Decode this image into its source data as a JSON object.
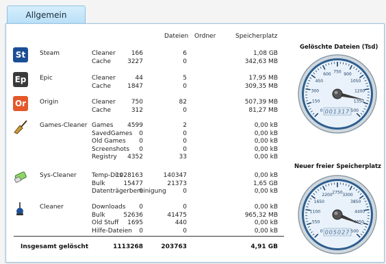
{
  "tabs": [
    {
      "label": "Allgemein"
    }
  ],
  "columns": {
    "files": "Dateien",
    "folders": "Ordner",
    "storage": "Speicherplatz"
  },
  "apps": [
    {
      "icon_text": "St",
      "icon_color": "#1b4f95",
      "name": "Steam",
      "rows": [
        {
          "category": "Cleaner",
          "files": "166",
          "folders": "6",
          "storage": "1,08 GB"
        },
        {
          "category": "Cache",
          "files": "3227",
          "folders": "0",
          "storage": "342,63 MB"
        }
      ]
    },
    {
      "icon_text": "Ep",
      "icon_color": "#3a3a3a",
      "name": "Epic",
      "rows": [
        {
          "category": "Cleaner",
          "files": "44",
          "folders": "5",
          "storage": "17,95 MB"
        },
        {
          "category": "Cache",
          "files": "1847",
          "folders": "0",
          "storage": "309,35 MB"
        }
      ]
    },
    {
      "icon_text": "Or",
      "icon_color": "#e4582a",
      "name": "Origin",
      "rows": [
        {
          "category": "Cleaner",
          "files": "750",
          "folders": "82",
          "storage": "507,39 MB"
        },
        {
          "category": "Cache",
          "files": "312",
          "folders": "0",
          "storage": "81,27 MB"
        }
      ]
    },
    {
      "icon_text": "",
      "icon_name": "broom-icon",
      "name": "Games-Cleaner",
      "rows": [
        {
          "category": "Games",
          "files": "4599",
          "folders": "2",
          "storage": "0,00 kB"
        },
        {
          "category": "SavedGames",
          "files": "0",
          "folders": "0",
          "storage": "0,00 kB"
        },
        {
          "category": "Old Games",
          "files": "0",
          "folders": "0",
          "storage": "0,00 kB"
        },
        {
          "category": "Screenshots",
          "files": "0",
          "folders": "0",
          "storage": "0,00 kB"
        },
        {
          "category": "Registry",
          "files": "4352",
          "folders": "33",
          "storage": "0,00 kB"
        }
      ]
    },
    {
      "icon_text": "",
      "icon_name": "eraser-icon",
      "name": "Sys-Cleaner",
      "rows": [
        {
          "category": "Temp-Dirs",
          "files": "1028163",
          "folders": "140347",
          "storage": "0,00 kB"
        },
        {
          "category": "Bulk",
          "files": "15477",
          "folders": "21373",
          "storage": "1,65 GB"
        },
        {
          "category": "Datenträgerbereinigung",
          "files": "0",
          "folders": "0",
          "storage": "0,00 kB"
        }
      ]
    },
    {
      "icon_text": "",
      "icon_name": "vacuum-icon",
      "name": "Cleaner",
      "rows": [
        {
          "category": "Downloads",
          "files": "0",
          "folders": "0",
          "storage": "0,00 kB"
        },
        {
          "category": "Bulk",
          "files": "52636",
          "folders": "41475",
          "storage": "965,32 MB"
        },
        {
          "category": "Old Stuff",
          "files": "1695",
          "folders": "440",
          "storage": "0,00 kB"
        },
        {
          "category": "Hilfe-Dateien",
          "files": "0",
          "folders": "0",
          "storage": "0,00 kB"
        }
      ]
    }
  ],
  "total": {
    "label": "Insgesamt gelöscht",
    "files": "1113268",
    "folders": "203763",
    "storage": "4,91 GB"
  },
  "gauges": [
    {
      "title": "Gelöschte Dateien (Tsd)",
      "ticks": [
        "0",
        "150",
        "300",
        "450",
        "600",
        "750",
        "900",
        "1050",
        "1200",
        "1350",
        "1500"
      ],
      "readout": "001317",
      "value": 1317,
      "max": 1500
    },
    {
      "title": "Neuer freier Speicherplatz",
      "ticks": [
        "0",
        "550",
        "1100",
        "1650",
        "2200",
        "2750",
        "3300",
        "3850",
        "4400",
        "4950",
        "5500"
      ],
      "readout": "005027",
      "value": 5027,
      "max": 5500
    }
  ]
}
